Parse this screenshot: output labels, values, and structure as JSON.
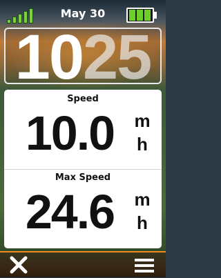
{
  "status": {
    "date": "May 30",
    "signal_bars": 5,
    "battery_level": 1.0,
    "accent_color": "#6bd12a"
  },
  "clock": {
    "hours": "10",
    "minutes": "25"
  },
  "fields": [
    {
      "label": "Speed",
      "value": "10.0",
      "unit_top": "m",
      "unit_bottom": "h"
    },
    {
      "label": "Max Speed",
      "value": "24.6",
      "unit_top": "m",
      "unit_bottom": "h"
    }
  ],
  "toolbar": {
    "close_icon": "close-icon",
    "menu_icon": "menu-icon",
    "accent": "#ff8a1a"
  }
}
